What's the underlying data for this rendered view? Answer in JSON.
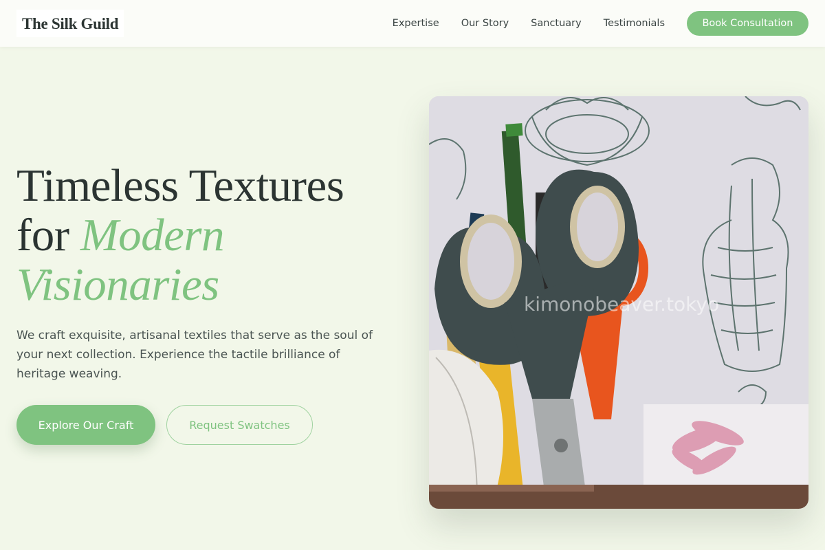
{
  "header": {
    "brand": "The Silk Guild",
    "nav": [
      "Expertise",
      "Our Story",
      "Sanctuary",
      "Testimonials"
    ],
    "cta_label": "Book Consultation"
  },
  "hero": {
    "title_line1": "Timeless Textures",
    "title_for": "for ",
    "title_accent1": "Modern",
    "title_accent2": "Visionaries",
    "description": "We craft exquisite, artisanal textiles that serve as the soul of your next collection. Experience the tactile brilliance of heritage weaving.",
    "primary_button": "Explore Our Craft",
    "secondary_button": "Request Swatches",
    "image_watermark": "kimonobeaver.tokyo"
  },
  "colors": {
    "accent": "#7fc380",
    "background": "#f2f7e9",
    "text": "#2b3432"
  }
}
